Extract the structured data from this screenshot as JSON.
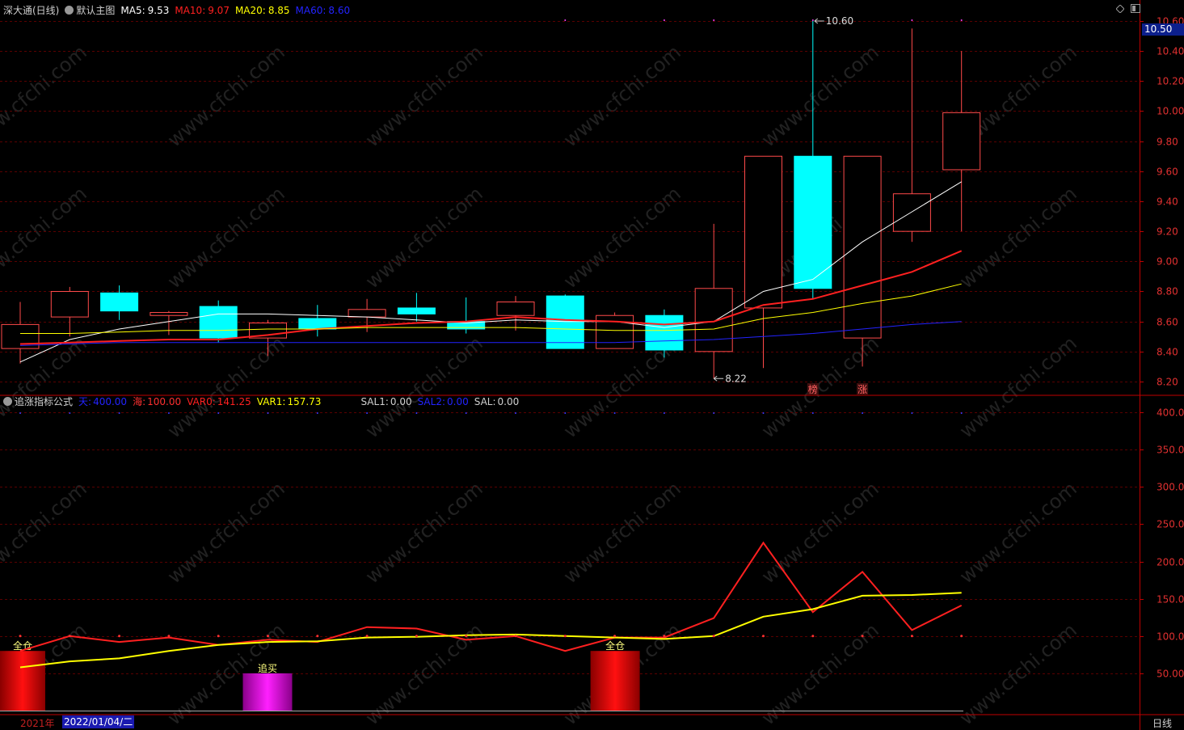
{
  "main_header": {
    "title": "深大通(日线)",
    "formula": "默认主图",
    "ma5_label": "MA5:",
    "ma5": "9.53",
    "ma10_label": "MA10:",
    "ma10": "9.07",
    "ma20_label": "MA20:",
    "ma20": "8.85",
    "ma60_label": "MA60:",
    "ma60": "8.60"
  },
  "sub_header": {
    "title": "追涨指标公式",
    "tian_label": "天:",
    "tian": "400.00",
    "hai_label": "海:",
    "hai": "100.00",
    "var0_label": "VAR0:",
    "var0": "141.25",
    "var1_label": "VAR1:",
    "var1": "157.73",
    "sal1_label": "SAL1:",
    "sal1": "0.00",
    "sal2_label": "SAL2:",
    "sal2": "0.00",
    "sal_label": "SAL:",
    "sal": "0.00"
  },
  "price_badge": "10.50",
  "bottom_bar": {
    "year": "2021年",
    "date": "2022/01/04/二",
    "period": "日线"
  },
  "watermark": "www.cfchi.com",
  "colors": {
    "up": "#ff4a4a",
    "down": "#00ffff",
    "ma5": "#ffffff",
    "ma10": "#ff2020",
    "ma20": "#ffff00",
    "ma60": "#2323ff",
    "grid": "#5a0000",
    "axis": "#c00000"
  },
  "chart_data": [
    {
      "type": "candlestick",
      "name": "主图",
      "y_ticks": [
        "10.60",
        "10.40",
        "10.20",
        "10.00",
        "9.80",
        "9.60",
        "9.40",
        "9.20",
        "9.00",
        "8.80",
        "8.60",
        "8.40",
        "8.20"
      ],
      "ylim": [
        8.13,
        10.68
      ],
      "candles": [
        {
          "o": 8.42,
          "h": 8.73,
          "l": 8.32,
          "c": 8.58
        },
        {
          "o": 8.63,
          "h": 8.83,
          "l": 8.5,
          "c": 8.8
        },
        {
          "o": 8.79,
          "h": 8.84,
          "l": 8.61,
          "c": 8.67
        },
        {
          "o": 8.64,
          "h": 8.67,
          "l": 8.51,
          "c": 8.66
        },
        {
          "o": 8.7,
          "h": 8.74,
          "l": 8.46,
          "c": 8.49
        },
        {
          "o": 8.49,
          "h": 8.61,
          "l": 8.37,
          "c": 8.59
        },
        {
          "o": 8.62,
          "h": 8.71,
          "l": 8.5,
          "c": 8.55
        },
        {
          "o": 8.63,
          "h": 8.75,
          "l": 8.53,
          "c": 8.68
        },
        {
          "o": 8.69,
          "h": 8.79,
          "l": 8.6,
          "c": 8.65
        },
        {
          "o": 8.6,
          "h": 8.76,
          "l": 8.52,
          "c": 8.55
        },
        {
          "o": 8.64,
          "h": 8.77,
          "l": 8.54,
          "c": 8.73
        },
        {
          "o": 8.77,
          "h": 8.78,
          "l": 8.42,
          "c": 8.42
        },
        {
          "o": 8.42,
          "h": 8.66,
          "l": 8.42,
          "c": 8.64
        },
        {
          "o": 8.64,
          "h": 8.68,
          "l": 8.36,
          "c": 8.41
        },
        {
          "o": 8.4,
          "h": 9.25,
          "l": 8.22,
          "c": 8.82
        },
        {
          "o": 8.69,
          "h": 9.7,
          "l": 8.29,
          "c": 9.7
        },
        {
          "o": 9.7,
          "h": 10.6,
          "l": 8.75,
          "c": 8.82
        },
        {
          "o": 8.49,
          "h": 9.7,
          "l": 8.3,
          "c": 9.7
        },
        {
          "o": 9.2,
          "h": 10.55,
          "l": 9.13,
          "c": 9.45
        },
        {
          "o": 9.61,
          "h": 10.4,
          "l": 9.2,
          "c": 9.99
        }
      ],
      "series": [
        {
          "name": "MA5",
          "values": [
            8.33,
            8.48,
            8.55,
            8.6,
            8.65,
            8.65,
            8.64,
            8.63,
            8.61,
            8.59,
            8.61,
            8.6,
            8.6,
            8.56,
            8.6,
            8.8,
            8.88,
            9.13,
            9.33,
            9.53
          ]
        },
        {
          "name": "MA10",
          "values": [
            8.45,
            8.46,
            8.47,
            8.48,
            8.48,
            8.51,
            8.55,
            8.57,
            8.59,
            8.6,
            8.63,
            8.61,
            8.6,
            8.58,
            8.6,
            8.71,
            8.75,
            8.84,
            8.93,
            9.07
          ]
        },
        {
          "name": "MA20",
          "values": [
            8.52,
            8.52,
            8.53,
            8.54,
            8.54,
            8.55,
            8.55,
            8.56,
            8.56,
            8.56,
            8.56,
            8.55,
            8.54,
            8.54,
            8.55,
            8.62,
            8.66,
            8.72,
            8.77,
            8.85
          ]
        },
        {
          "name": "MA60",
          "values": [
            8.44,
            8.45,
            8.46,
            8.46,
            8.46,
            8.46,
            8.46,
            8.46,
            8.46,
            8.46,
            8.46,
            8.46,
            8.46,
            8.47,
            8.48,
            8.5,
            8.52,
            8.55,
            8.58,
            8.6
          ]
        }
      ],
      "annotations": [
        {
          "index": 16,
          "price": 10.6,
          "text": "10.60",
          "kind": "high"
        },
        {
          "index": 14,
          "price": 8.22,
          "text": "8.22",
          "kind": "low"
        },
        {
          "index": 16,
          "text": "榜",
          "kind": "tag"
        },
        {
          "index": 17,
          "text": "涨",
          "kind": "tag"
        }
      ]
    },
    {
      "type": "line",
      "name": "追涨指标公式",
      "y_ticks": [
        "400.0",
        "350.0",
        "300.0",
        "250.0",
        "200.0",
        "150.0",
        "100.0",
        "50.00"
      ],
      "ylim": [
        0,
        415
      ],
      "series": [
        {
          "name": "VAR0",
          "values": [
            80,
            100,
            92,
            98,
            88,
            95,
            92,
            112,
            110,
            95,
            100,
            80,
            98,
            98,
            124,
            225,
            132,
            186,
            108,
            141
          ]
        },
        {
          "name": "VAR1",
          "values": [
            58,
            66,
            70,
            80,
            88,
            92,
            93,
            98,
            99,
            101,
            102,
            100,
            98,
            96,
            100,
            126,
            136,
            154,
            155,
            158
          ]
        },
        {
          "name": "天",
          "values": [
            400,
            400,
            400,
            400,
            400,
            400,
            400,
            400,
            400,
            400,
            400,
            400,
            400,
            400,
            400,
            400,
            400,
            400,
            400,
            400
          ]
        },
        {
          "name": "海",
          "values": [
            100,
            100,
            100,
            100,
            100,
            100,
            100,
            100,
            100,
            100,
            100,
            100,
            100,
            100,
            100,
            100,
            100,
            100,
            100,
            100
          ]
        }
      ],
      "signals": [
        {
          "start": 0,
          "end": 0,
          "value": 80,
          "text": "全仓",
          "color": "red"
        },
        {
          "start": 5,
          "end": 5,
          "value": 50,
          "text": "追买",
          "color": "magenta"
        },
        {
          "start": 12,
          "end": 12,
          "value": 80,
          "text": "全仓",
          "color": "red"
        }
      ]
    }
  ]
}
